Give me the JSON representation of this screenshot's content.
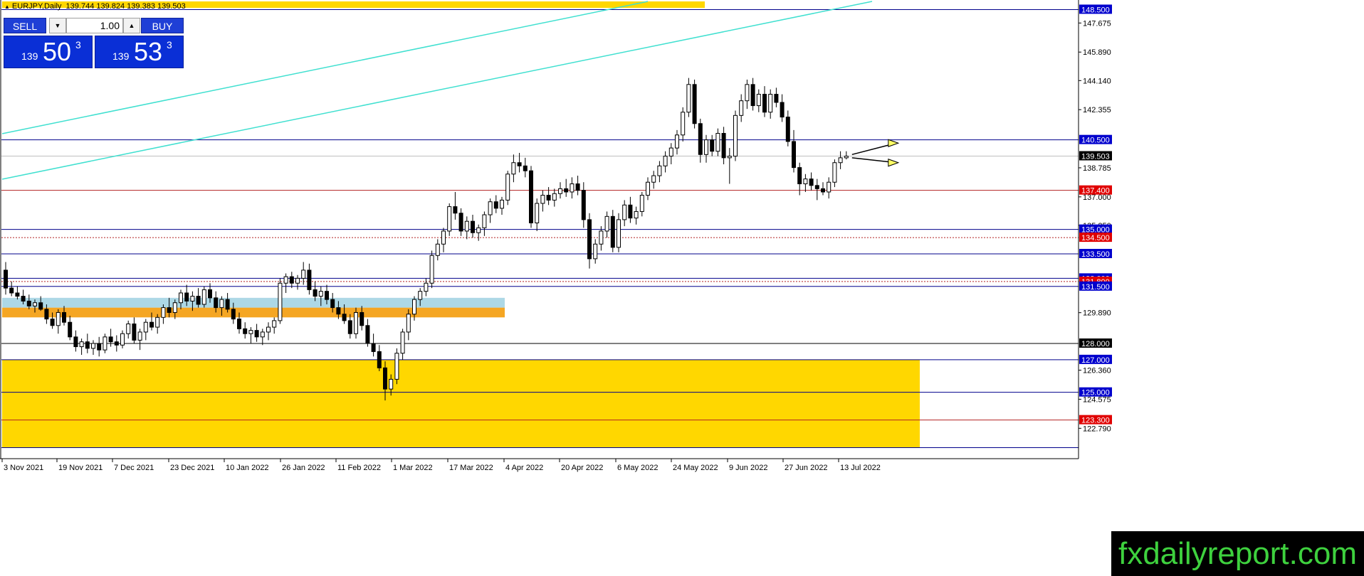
{
  "header": {
    "symbol_tf": "EURJPY,Daily",
    "ohlc": "139.744 139.824 139.383 139.503"
  },
  "trade_panel": {
    "sell_label": "SELL",
    "buy_label": "BUY",
    "lot": "1.00",
    "sell_small": "139",
    "sell_big": "50",
    "sell_pip": "3",
    "buy_small": "139",
    "buy_big": "53",
    "buy_pip": "3"
  },
  "brand": "fxdailyreport.com",
  "colors": {
    "bull": "#ffffff",
    "bear": "#000000",
    "blue_line": "#00008b",
    "red_line": "#b22222",
    "teal": "#40e0d0",
    "yellow_zone": "#ffd700",
    "orange_zone": "#f5a623",
    "lightblue_zone": "#add8e6",
    "arrow_fill": "#ffff66"
  },
  "chart_data": {
    "type": "candlestick",
    "symbol": "EURJPY",
    "timeframe": "Daily",
    "ylim": [
      121.1,
      149.0
    ],
    "grid": false,
    "y_ticks": [
      "147.675",
      "145.890",
      "144.140",
      "142.355",
      "138.785",
      "137.000",
      "135.250",
      "129.890",
      "126.360",
      "124.575",
      "122.790"
    ],
    "x_labels": [
      "3 Nov 2021",
      "19 Nov 2021",
      "7 Dec 2021",
      "23 Dec 2021",
      "10 Jan 2022",
      "26 Jan 2022",
      "11 Feb 2022",
      "1 Mar 2022",
      "17 Mar 2022",
      "4 Apr 2022",
      "20 Apr 2022",
      "6 May 2022",
      "24 May 2022",
      "9 Jun 2022",
      "27 Jun 2022",
      "13 Jul 2022"
    ],
    "current_price": {
      "value": 139.503,
      "label": "139.503"
    },
    "price_levels": [
      {
        "value": 148.5,
        "label": "148.500",
        "color": "blue",
        "style": "solid",
        "tag_bg": "#0000cd"
      },
      {
        "value": 140.5,
        "label": "140.500",
        "color": "blue",
        "style": "solid",
        "tag_bg": "#0000cd"
      },
      {
        "value": 137.4,
        "label": "137.400",
        "color": "red",
        "style": "solid",
        "tag_bg": "#e00000"
      },
      {
        "value": 135.0,
        "label": "135.000",
        "color": "blue",
        "style": "solid",
        "tag_bg": "#0000cd"
      },
      {
        "value": 134.5,
        "label": "134.500",
        "color": "red",
        "style": "dotted",
        "tag_bg": "#e00000"
      },
      {
        "value": 133.5,
        "label": "133.500",
        "color": "blue",
        "style": "solid",
        "tag_bg": "#0000cd"
      },
      {
        "value": 132.0,
        "label": "132.000",
        "color": "blue",
        "style": "solid",
        "tag_bg": "#0000cd"
      },
      {
        "value": 131.8,
        "label": "131.800",
        "color": "red",
        "style": "dotted",
        "tag_bg": "#e00000"
      },
      {
        "value": 131.5,
        "label": "131.500",
        "color": "blue",
        "style": "solid",
        "tag_bg": "#0000cd"
      },
      {
        "value": 128.0,
        "label": "128.000",
        "color": "black",
        "style": "solid",
        "tag_bg": "#000000"
      },
      {
        "value": 127.0,
        "label": "127.000",
        "color": "blue",
        "style": "solid",
        "tag_bg": "#0000cd"
      },
      {
        "value": 125.0,
        "label": "125.000",
        "color": "blue",
        "style": "solid",
        "tag_bg": "#0000cd"
      },
      {
        "value": 123.3,
        "label": "123.300",
        "color": "red",
        "style": "solid",
        "tag_bg": "#e00000"
      },
      {
        "value": 121.6,
        "label": "",
        "color": "blue",
        "style": "solid",
        "tag_bg": ""
      }
    ],
    "zones": [
      {
        "name": "support-zone-yellow",
        "from": 121.6,
        "to": 127.0,
        "color": "yellow",
        "end_x_label": "20 Jul 2022"
      },
      {
        "name": "support-zone-orange",
        "from": 129.6,
        "to": 130.2,
        "color": "orange",
        "end_x_label": "4 Apr 2022"
      },
      {
        "name": "support-zone-lightblue",
        "from": 130.2,
        "to": 130.8,
        "color": "lightblue",
        "end_x_label": "4 Apr 2022"
      },
      {
        "name": "top-zone-yellow",
        "from": 148.6,
        "to": 149.0,
        "color": "yellow",
        "end_x_label": "27 Jun 2022"
      }
    ],
    "trendlines": [
      {
        "name": "upper-channel-line",
        "y_start": 140.5,
        "y_end": 149.0
      },
      {
        "name": "lower-channel-line",
        "y_start": 138.2,
        "y_end": 149.0
      }
    ],
    "arrows": [
      {
        "name": "forecast-arrow-up",
        "from": 139.6,
        "to": 140.3
      },
      {
        "name": "forecast-arrow-down",
        "from": 139.4,
        "to": 139.1
      }
    ],
    "candles": [
      [
        132.5,
        133.0,
        131.0,
        131.4
      ],
      [
        131.4,
        131.8,
        130.9,
        131.1
      ],
      [
        131.1,
        131.5,
        130.7,
        130.9
      ],
      [
        130.9,
        131.3,
        130.4,
        130.6
      ],
      [
        130.6,
        131.0,
        130.1,
        130.3
      ],
      [
        130.3,
        130.7,
        129.9,
        130.5
      ],
      [
        130.5,
        130.9,
        130.0,
        130.1
      ],
      [
        130.1,
        130.4,
        129.2,
        129.5
      ],
      [
        129.5,
        129.9,
        128.9,
        129.1
      ],
      [
        129.1,
        130.1,
        128.6,
        129.9
      ],
      [
        129.9,
        130.3,
        129.1,
        129.3
      ],
      [
        129.3,
        129.7,
        128.2,
        128.4
      ],
      [
        128.4,
        128.8,
        127.5,
        127.8
      ],
      [
        127.8,
        128.3,
        127.3,
        128.1
      ],
      [
        128.1,
        128.6,
        127.4,
        127.7
      ],
      [
        127.7,
        128.2,
        127.3,
        128.0
      ],
      [
        128.0,
        128.4,
        127.2,
        127.6
      ],
      [
        127.6,
        128.6,
        127.4,
        128.4
      ],
      [
        128.4,
        128.9,
        127.8,
        128.1
      ],
      [
        128.1,
        128.5,
        127.5,
        127.9
      ],
      [
        127.9,
        128.8,
        127.7,
        128.6
      ],
      [
        128.6,
        129.4,
        128.3,
        129.2
      ],
      [
        129.2,
        129.6,
        128.0,
        128.2
      ],
      [
        128.2,
        128.9,
        127.6,
        128.7
      ],
      [
        128.7,
        129.5,
        128.2,
        129.3
      ],
      [
        129.3,
        129.9,
        128.8,
        129.0
      ],
      [
        129.0,
        129.8,
        128.6,
        129.6
      ],
      [
        129.6,
        130.4,
        129.2,
        130.2
      ],
      [
        130.2,
        130.8,
        129.6,
        129.9
      ],
      [
        129.9,
        130.7,
        129.5,
        130.5
      ],
      [
        130.5,
        131.3,
        130.1,
        131.1
      ],
      [
        131.1,
        131.6,
        130.3,
        130.6
      ],
      [
        130.6,
        131.2,
        130.0,
        130.9
      ],
      [
        130.9,
        131.4,
        130.2,
        130.4
      ],
      [
        130.4,
        131.5,
        130.2,
        131.3
      ],
      [
        131.3,
        131.7,
        130.5,
        130.8
      ],
      [
        130.8,
        131.2,
        129.9,
        130.2
      ],
      [
        130.2,
        130.9,
        129.7,
        130.7
      ],
      [
        130.7,
        131.1,
        129.9,
        130.1
      ],
      [
        130.1,
        130.5,
        129.2,
        129.5
      ],
      [
        129.5,
        129.9,
        128.6,
        128.9
      ],
      [
        128.9,
        129.3,
        128.3,
        128.6
      ],
      [
        128.6,
        129.0,
        128.0,
        128.8
      ],
      [
        128.8,
        129.2,
        128.1,
        128.4
      ],
      [
        128.4,
        128.9,
        127.9,
        128.7
      ],
      [
        128.7,
        129.3,
        128.2,
        129.0
      ],
      [
        129.0,
        129.6,
        128.6,
        129.4
      ],
      [
        129.4,
        132.0,
        129.2,
        131.7
      ],
      [
        131.7,
        132.3,
        131.1,
        132.1
      ],
      [
        132.1,
        132.4,
        131.4,
        131.7
      ],
      [
        131.7,
        132.2,
        131.3,
        132.0
      ],
      [
        132.0,
        133.0,
        131.6,
        132.5
      ],
      [
        132.5,
        132.9,
        131.0,
        131.3
      ],
      [
        131.3,
        131.8,
        130.6,
        130.9
      ],
      [
        130.9,
        131.5,
        130.3,
        131.2
      ],
      [
        131.2,
        131.6,
        130.4,
        130.7
      ],
      [
        130.7,
        131.1,
        129.9,
        130.2
      ],
      [
        130.2,
        130.6,
        129.5,
        129.8
      ],
      [
        129.8,
        130.4,
        129.2,
        129.4
      ],
      [
        129.4,
        129.8,
        128.3,
        128.6
      ],
      [
        128.6,
        130.2,
        128.3,
        129.9
      ],
      [
        129.9,
        130.3,
        128.8,
        129.1
      ],
      [
        129.1,
        129.5,
        127.8,
        128.0
      ],
      [
        128.0,
        128.6,
        127.2,
        127.5
      ],
      [
        127.5,
        127.9,
        126.3,
        126.5
      ],
      [
        126.5,
        126.9,
        124.5,
        125.2
      ],
      [
        125.2,
        126.1,
        124.8,
        125.8
      ],
      [
        125.8,
        127.7,
        125.5,
        127.4
      ],
      [
        127.4,
        128.9,
        127.0,
        128.7
      ],
      [
        128.7,
        130.1,
        128.2,
        129.8
      ],
      [
        129.8,
        130.9,
        129.4,
        130.7
      ],
      [
        130.7,
        131.4,
        130.3,
        131.2
      ],
      [
        131.2,
        132.0,
        130.9,
        131.7
      ],
      [
        131.7,
        133.7,
        131.4,
        133.4
      ],
      [
        133.4,
        134.4,
        133.1,
        134.1
      ],
      [
        134.1,
        135.1,
        133.6,
        134.9
      ],
      [
        134.9,
        136.6,
        134.6,
        136.4
      ],
      [
        136.4,
        137.3,
        135.6,
        136.0
      ],
      [
        136.0,
        136.3,
        134.6,
        134.9
      ],
      [
        134.9,
        135.8,
        134.4,
        135.5
      ],
      [
        135.5,
        135.9,
        134.5,
        134.8
      ],
      [
        134.8,
        135.3,
        134.3,
        135.1
      ],
      [
        135.1,
        136.1,
        134.6,
        135.9
      ],
      [
        135.9,
        136.9,
        135.4,
        136.7
      ],
      [
        136.7,
        137.1,
        136.0,
        136.3
      ],
      [
        136.3,
        137.0,
        135.9,
        136.8
      ],
      [
        136.8,
        138.6,
        136.5,
        138.4
      ],
      [
        138.4,
        139.6,
        137.9,
        139.1
      ],
      [
        139.1,
        139.7,
        138.5,
        138.9
      ],
      [
        138.9,
        139.4,
        138.2,
        138.6
      ],
      [
        138.6,
        138.9,
        135.1,
        135.4
      ],
      [
        135.4,
        136.9,
        134.9,
        136.6
      ],
      [
        136.6,
        137.4,
        136.1,
        137.1
      ],
      [
        137.1,
        137.6,
        136.5,
        136.8
      ],
      [
        136.8,
        137.5,
        136.4,
        137.2
      ],
      [
        137.2,
        137.9,
        136.9,
        137.5
      ],
      [
        137.5,
        138.1,
        137.0,
        137.3
      ],
      [
        137.3,
        138.2,
        136.9,
        137.8
      ],
      [
        137.8,
        138.3,
        137.1,
        137.4
      ],
      [
        137.4,
        137.9,
        135.1,
        135.6
      ],
      [
        135.6,
        136.0,
        132.6,
        133.2
      ],
      [
        133.2,
        134.4,
        132.9,
        134.1
      ],
      [
        134.1,
        135.2,
        133.7,
        134.9
      ],
      [
        134.9,
        136.1,
        134.5,
        135.8
      ],
      [
        135.8,
        136.2,
        133.6,
        133.9
      ],
      [
        133.9,
        136.0,
        133.6,
        135.6
      ],
      [
        135.6,
        136.8,
        135.2,
        136.5
      ],
      [
        136.5,
        137.0,
        135.4,
        135.7
      ],
      [
        135.7,
        136.4,
        135.3,
        136.1
      ],
      [
        136.1,
        137.3,
        135.8,
        137.1
      ],
      [
        137.1,
        138.2,
        136.8,
        137.9
      ],
      [
        137.9,
        138.6,
        137.5,
        138.3
      ],
      [
        138.3,
        139.2,
        137.9,
        138.9
      ],
      [
        138.9,
        139.8,
        138.5,
        139.5
      ],
      [
        139.5,
        140.3,
        139.0,
        140.0
      ],
      [
        140.0,
        141.1,
        139.6,
        140.8
      ],
      [
        140.8,
        142.5,
        140.4,
        142.2
      ],
      [
        142.2,
        144.3,
        141.9,
        143.9
      ],
      [
        143.9,
        144.2,
        141.2,
        141.5
      ],
      [
        141.5,
        141.8,
        139.1,
        139.6
      ],
      [
        139.6,
        140.8,
        139.1,
        140.5
      ],
      [
        140.5,
        140.8,
        139.5,
        139.8
      ],
      [
        139.8,
        141.2,
        139.5,
        140.9
      ],
      [
        140.9,
        141.3,
        139.0,
        139.4
      ],
      [
        139.4,
        140.0,
        137.8,
        139.5
      ],
      [
        139.5,
        142.3,
        139.2,
        142.0
      ],
      [
        142.0,
        143.3,
        141.6,
        142.9
      ],
      [
        142.9,
        144.2,
        142.4,
        143.9
      ],
      [
        143.9,
        144.3,
        142.3,
        142.6
      ],
      [
        142.6,
        143.6,
        142.2,
        143.3
      ],
      [
        143.3,
        143.8,
        141.9,
        142.2
      ],
      [
        142.2,
        143.6,
        141.8,
        143.3
      ],
      [
        143.3,
        143.7,
        142.5,
        142.8
      ],
      [
        142.8,
        143.3,
        141.6,
        141.9
      ],
      [
        141.9,
        142.3,
        140.1,
        140.4
      ],
      [
        140.4,
        141.1,
        138.5,
        138.8
      ],
      [
        138.8,
        139.1,
        137.1,
        137.8
      ],
      [
        137.8,
        138.4,
        137.3,
        138.1
      ],
      [
        138.1,
        138.5,
        137.4,
        137.7
      ],
      [
        137.7,
        138.1,
        136.8,
        137.5
      ],
      [
        137.5,
        137.9,
        137.1,
        137.3
      ],
      [
        137.3,
        138.2,
        136.9,
        137.9
      ],
      [
        137.9,
        139.3,
        137.6,
        139.1
      ],
      [
        139.1,
        139.8,
        138.7,
        139.4
      ],
      [
        139.4,
        139.8,
        139.3,
        139.5
      ]
    ]
  }
}
